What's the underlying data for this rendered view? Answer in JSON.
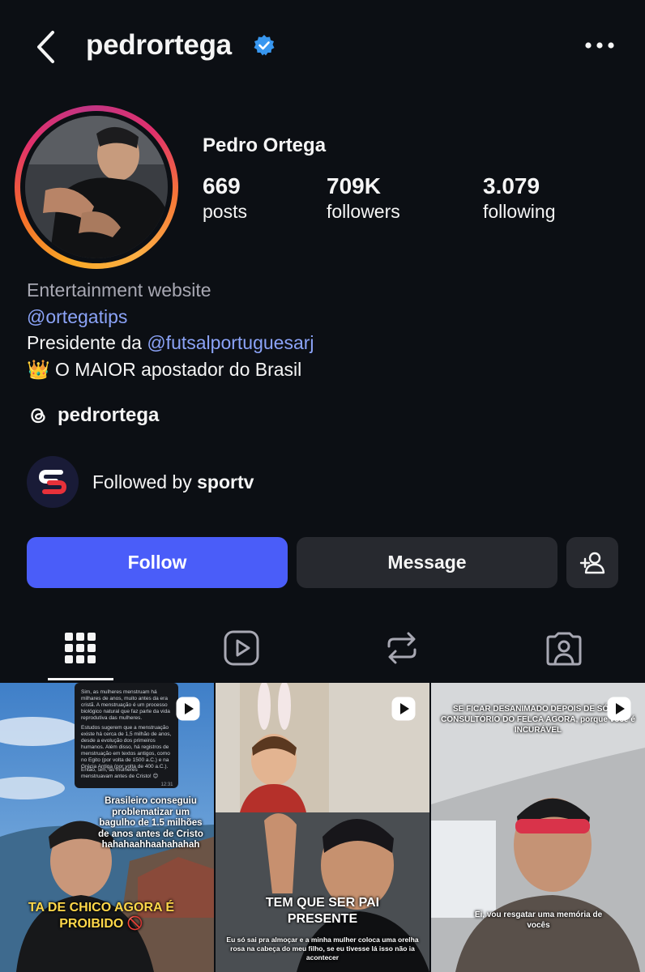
{
  "header": {
    "username": "pedrortega",
    "icons": {
      "back": "chevron-left-icon",
      "verified": "verified-badge-icon",
      "more": "more-horizontal-icon"
    }
  },
  "profile": {
    "full_name": "Pedro Ortega",
    "stats": [
      {
        "value": "669",
        "label": "posts"
      },
      {
        "value": "709K",
        "label": "followers"
      },
      {
        "value": "3.079",
        "label": "following"
      }
    ]
  },
  "bio": {
    "category": "Entertainment website",
    "link1": "@ortegatips",
    "line3_prefix": "Presidente da ",
    "line3_link": "@futsalportuguesarj",
    "line4_emoji": "👑",
    "line4_text": " O MAIOR apostador do Brasil"
  },
  "threads": {
    "handle": "pedrortega"
  },
  "followed_by": {
    "prefix": "Followed by ",
    "account": "sportv",
    "logo_letter": "S"
  },
  "actions": {
    "follow": "Follow",
    "message": "Message"
  },
  "tabs": [
    {
      "name": "grid",
      "icon": "grid-icon",
      "active": true
    },
    {
      "name": "reels",
      "icon": "reels-icon",
      "active": false
    },
    {
      "name": "reposts",
      "icon": "repost-icon",
      "active": false
    },
    {
      "name": "tagged",
      "icon": "tagged-icon",
      "active": false
    }
  ],
  "posts": [
    {
      "chat_text_1": "Sim, as mulheres menstruam há milhares de anos, muito antes da era cristã. A menstruação é um processo biológico natural que faz parte da vida reprodutiva das mulheres.",
      "chat_text_2": "Estudos sugerem que a menstruação existe há cerca de 1,5 milhão de anos, desde a evolução dos primeiros humanos. Além disso, há registros de menstruação em textos antigos, como no Egito (por volta de 1500 a.C.) e na Grécia Antiga (por volta de 400 a.C.).",
      "chat_text_3": "Então, sim, as mulheres menstruavam antes de Cristo! 😊",
      "chat_time": "12:31",
      "caption_mid": "Brasileiro conseguiu problematizar um bagulho de 1.5 milhões de anos antes de Cristo hahahaahhaahahahah",
      "caption_big": "TA DE CHICO AGORA É PROIBIDO 🚫"
    },
    {
      "caption_big": "TEM QUE SER PAI PRESENTE",
      "caption_small": "Eu só sai pra almoçar e a minha mulher coloca uma orelha rosa na cabeça do meu filho, se eu tivesse lá isso não ia acontecer"
    },
    {
      "caption_top": "SE FICAR DESANIMADO DEPOIS DE SÓ NO CONSULTÓRIO DO FELCA AGORA, porque você é INCURÁVEL",
      "caption_small": "Ei, vou resgatar uma memória de vocês"
    }
  ],
  "colors": {
    "accent": "#4a5df9",
    "link": "#8ba3f7",
    "background": "#0c0f14",
    "secondary_button": "#27292f"
  }
}
